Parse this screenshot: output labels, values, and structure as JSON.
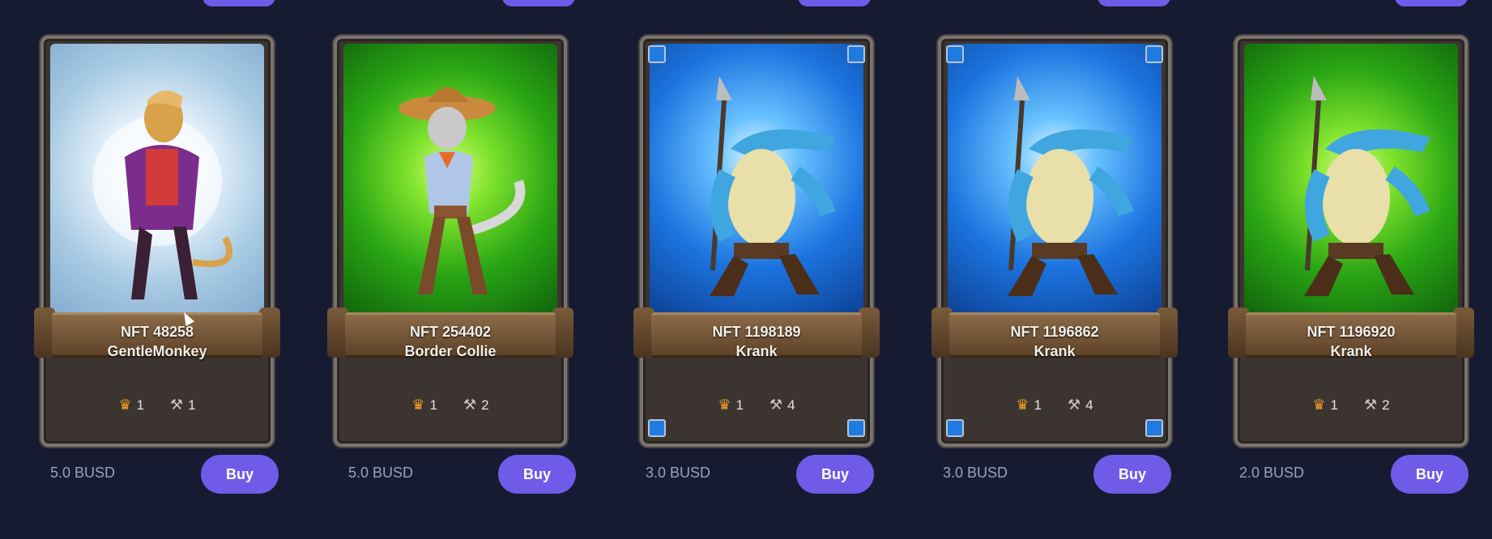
{
  "colors": {
    "background": "#161b31",
    "accent": "#6f5be8",
    "price_text": "#9aa2b8"
  },
  "icons": {
    "rank": "crown-icon",
    "tool": "hammer-icon"
  },
  "cards": [
    {
      "title": "NFT 48258",
      "name": "GentleMonkey",
      "rank": "1",
      "tool": "1",
      "price": "5.0 BUSD",
      "buy_label": "Buy",
      "rarity": "silver"
    },
    {
      "title": "NFT 254402",
      "name": "Border Collie",
      "rank": "1",
      "tool": "2",
      "price": "5.0 BUSD",
      "buy_label": "Buy",
      "rarity": "green"
    },
    {
      "title": "NFT 1198189",
      "name": "Krank",
      "rank": "1",
      "tool": "4",
      "price": "3.0 BUSD",
      "buy_label": "Buy",
      "rarity": "blue"
    },
    {
      "title": "NFT 1196862",
      "name": "Krank",
      "rank": "1",
      "tool": "4",
      "price": "3.0 BUSD",
      "buy_label": "Buy",
      "rarity": "blue"
    },
    {
      "title": "NFT 1196920",
      "name": "Krank",
      "rank": "1",
      "tool": "2",
      "price": "2.0 BUSD",
      "buy_label": "Buy",
      "rarity": "green"
    }
  ]
}
